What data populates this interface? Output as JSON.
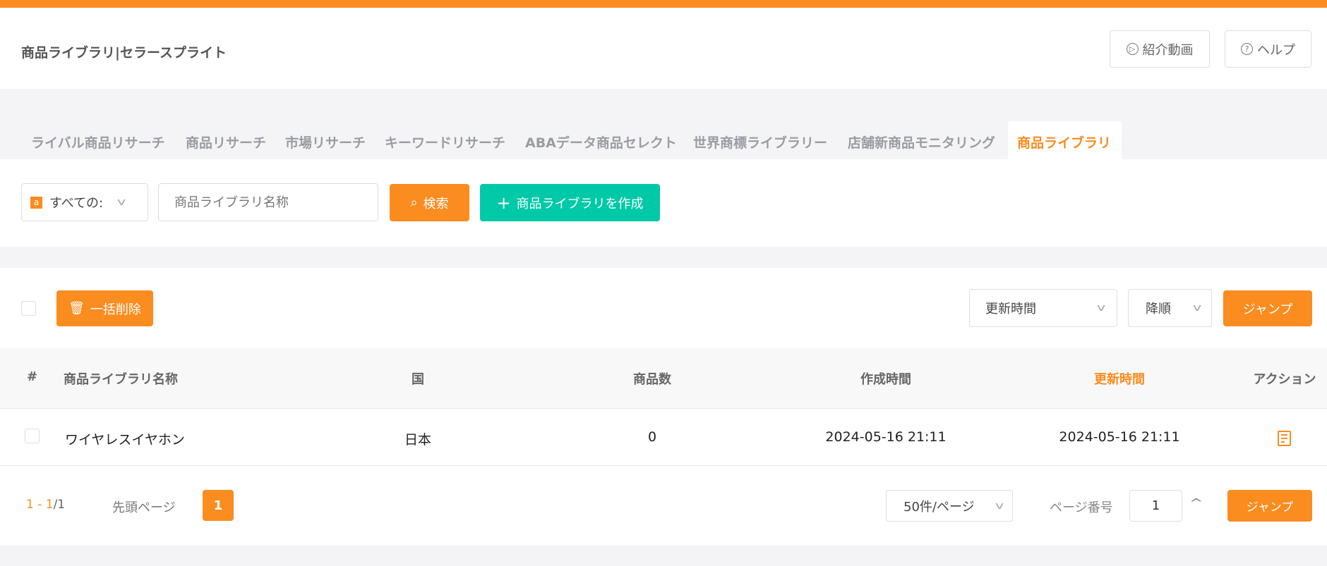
{
  "colors": {
    "accent": "#fb8c1f",
    "create": "#00c9a7"
  },
  "header": {
    "title": "商品ライブラリ|セラースプライト",
    "video_label": "紹介動画",
    "help_label": "ヘルプ"
  },
  "tabs": [
    {
      "label": "ライバル商品リサーチ"
    },
    {
      "label": "商品リサーチ"
    },
    {
      "label": "市場リサーチ"
    },
    {
      "label": "キーワードリサーチ"
    },
    {
      "label": "ABAデータ商品セレクト"
    },
    {
      "label": "世界商標ライブラリー"
    },
    {
      "label": "店舗新商品モニタリング"
    },
    {
      "label": "商品ライブラリ",
      "active": true
    }
  ],
  "search": {
    "marketplace": "すべての:",
    "placeholder": "商品ライブラリ名称",
    "search_label": "検索",
    "create_label": "商品ライブラリを作成"
  },
  "toolbar": {
    "bulk_delete_label": "一括削除",
    "sort_field": "更新時間",
    "sort_order": "降順",
    "jump_label": "ジャンプ"
  },
  "table": {
    "headers": [
      "#",
      "商品ライブラリ名称",
      "国",
      "商品数",
      "作成時間",
      "更新時間",
      "アクション"
    ],
    "rows": [
      {
        "name": "ワイヤレスイヤホン",
        "country": "日本",
        "count": "0",
        "created": "2024-05-16 21:11",
        "updated": "2024-05-16 21:11"
      }
    ]
  },
  "pagination": {
    "range": "1 - 1",
    "total": "/1",
    "first_label": "先頭ページ",
    "current_page": "1",
    "page_size": "50件/ページ",
    "page_no_label": "ページ番号",
    "page_input": "1",
    "jump_label": "ジャンプ"
  }
}
